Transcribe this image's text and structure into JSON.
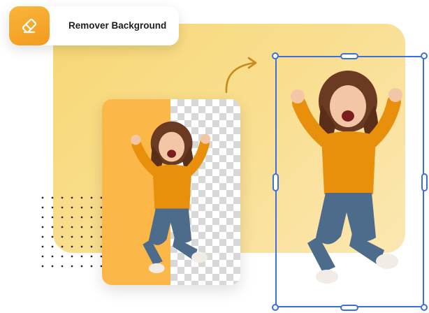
{
  "header": {
    "title": "Remover Background",
    "icon": "eraser-icon"
  },
  "colors": {
    "accent_orange": "#f7a32a",
    "backdrop_yellow": "#f8da80",
    "selection_blue": "#3b6fe0",
    "sweater": "#e8900c",
    "jeans": "#4d6b8a"
  },
  "illustrations": {
    "before_card": "jumping-woman-half-transparent",
    "after_frame": "jumping-woman-cutout",
    "arrow": "curved-arrow-icon"
  }
}
